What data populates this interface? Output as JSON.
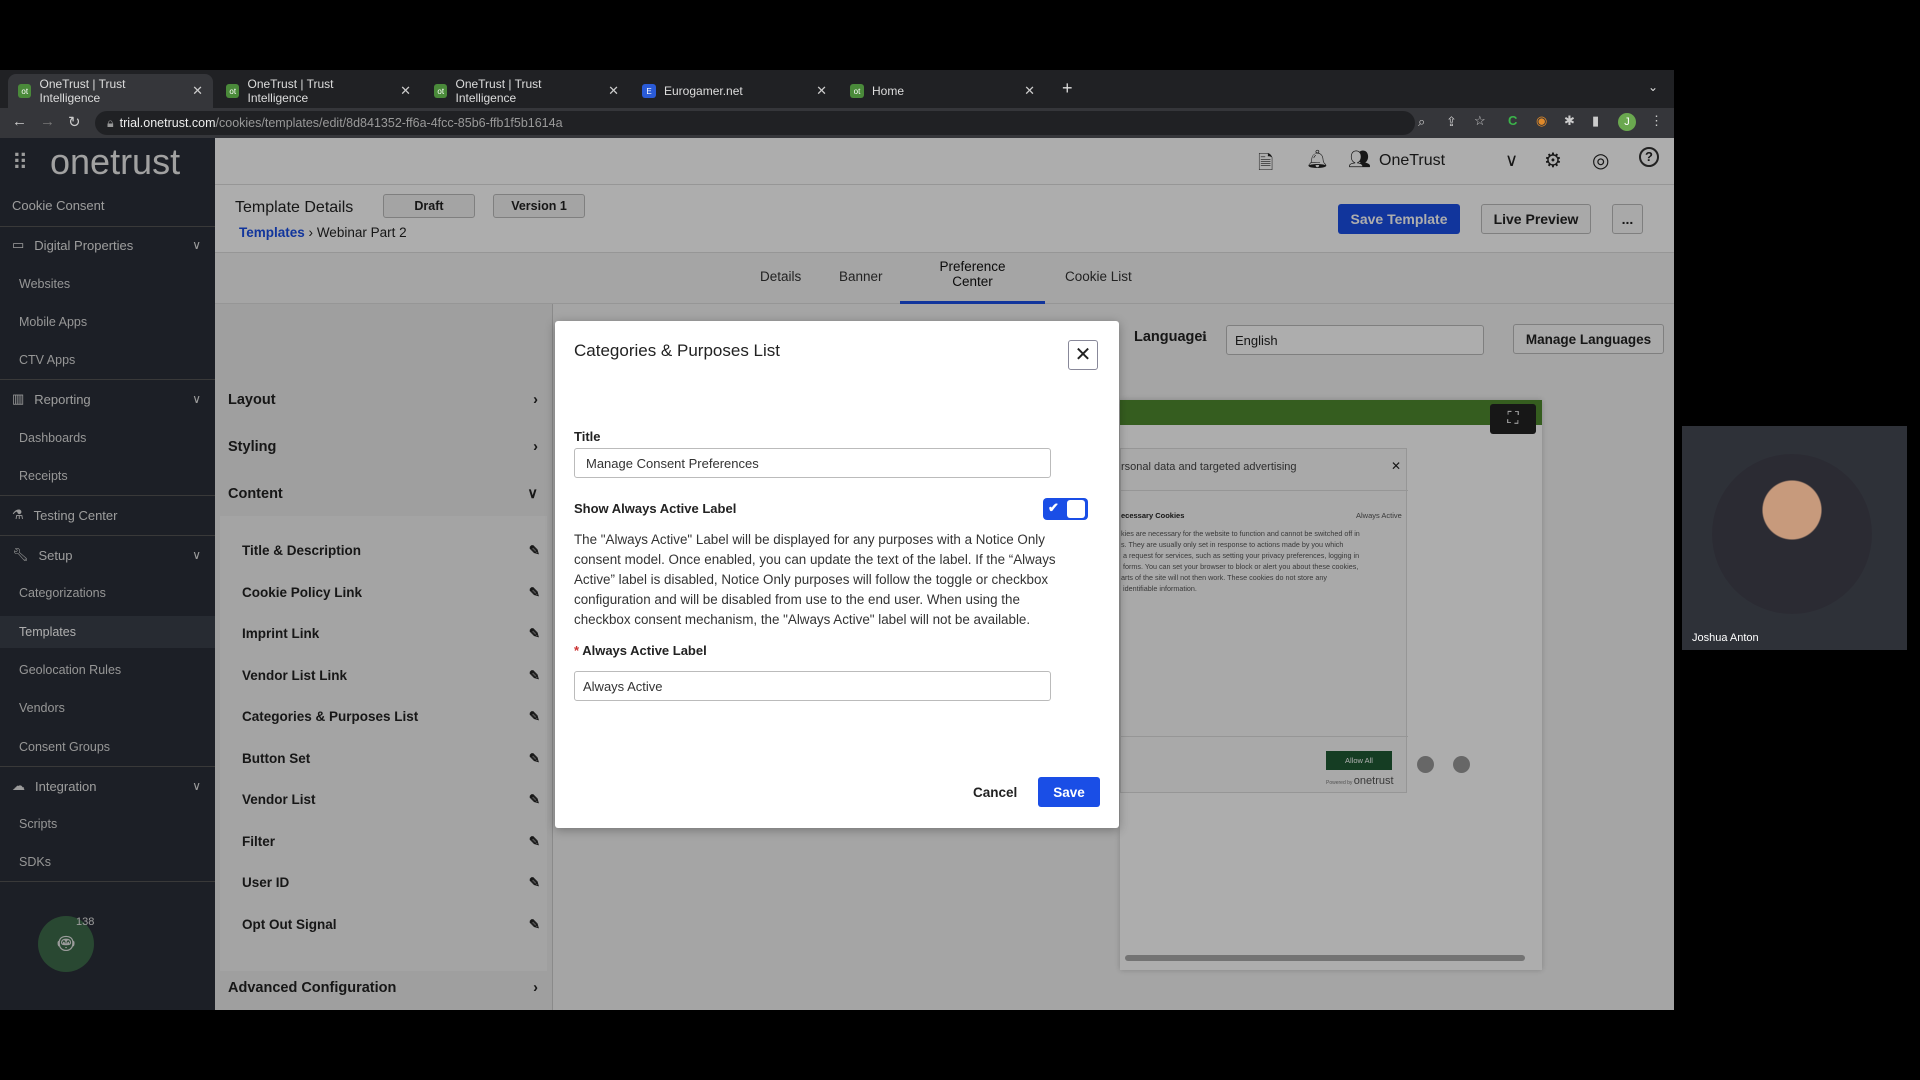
{
  "browser": {
    "tabs": [
      {
        "title": "OneTrust | Trust Intelligence",
        "icon": "ot"
      },
      {
        "title": "OneTrust | Trust Intelligence",
        "icon": "ot"
      },
      {
        "title": "OneTrust | Trust Intelligence",
        "icon": "ot"
      },
      {
        "title": "Eurogamer.net",
        "icon": "E"
      },
      {
        "title": "Home",
        "icon": "ot"
      }
    ],
    "url_host": "trial.onetrust.com",
    "url_path": "/cookies/templates/edit/8d841352-ff6a-4fcc-85b6-ffb1f5b1614a",
    "profile_initial": "J"
  },
  "logo": "onetrust",
  "sidebar": {
    "module": "Cookie Consent",
    "sections": [
      {
        "label": "Digital Properties",
        "items": [
          "Websites",
          "Mobile Apps",
          "CTV Apps"
        ]
      },
      {
        "label": "Reporting",
        "items": [
          "Dashboards",
          "Receipts"
        ]
      },
      {
        "label": "Testing Center",
        "items": []
      },
      {
        "label": "Setup",
        "items": [
          "Categorizations",
          "Templates",
          "Geolocation Rules",
          "Vendors",
          "Consent Groups"
        ]
      },
      {
        "label": "Integration",
        "items": [
          "Scripts",
          "SDKs"
        ]
      }
    ],
    "active": "Templates",
    "bot_badge": "138"
  },
  "header": {
    "org": "OneTrust"
  },
  "template": {
    "title": "Template Details",
    "status": "Draft",
    "version": "Version 1",
    "breadcrumb_root": "Templates",
    "breadcrumb_current": "Webinar Part 2",
    "save": "Save Template",
    "live_preview": "Live Preview",
    "more": "..."
  },
  "tabs": [
    "Details",
    "Banner",
    "Preference Center",
    "Cookie List"
  ],
  "active_tab": "Preference Center",
  "language": {
    "label": "Language",
    "value": "English",
    "manage": "Manage Languages"
  },
  "left_panel": {
    "sections": [
      "Layout",
      "Styling",
      "Content"
    ],
    "content_items": [
      "Title & Description",
      "Cookie Policy Link",
      "Imprint Link",
      "Vendor List Link",
      "Categories & Purposes List",
      "Button Set",
      "Vendor List",
      "Filter",
      "User ID",
      "Opt Out Signal"
    ],
    "advanced": "Advanced Configuration"
  },
  "preview": {
    "heading": "rsonal data and targeted advertising",
    "category": "ecessary Cookies",
    "always_active": "Always Active",
    "body": "kies are necessary for the website to function and cannot be switched off in\ns. They are usually only set in response to actions made by you which\n a request for services, such as setting your privacy preferences, logging in\n forms. You can set your browser to block or alert you about these cookies,\narts of the site will not then work. These cookies do not store any\n identifiable information.",
    "allow_all": "Allow All",
    "powered_by": "Powered by",
    "powered_logo": "onetrust"
  },
  "modal": {
    "title": "Categories & Purposes List",
    "title_label": "Title",
    "title_value": "Manage Consent Preferences",
    "toggle_label": "Show Always Active Label",
    "toggle_on": true,
    "description": "The \"Always Active\" Label will be displayed for any purposes with a Notice Only consent model. Once enabled, you can update the text of the label. If the “Always Active” label is disabled, Notice Only purposes will follow the toggle or checkbox configuration and will be disabled from use to the end user. When using the checkbox consent mechanism, the \"Always Active\" label will not be available.",
    "required_mark": "*",
    "label_field": "Always Active Label",
    "label_value": "Always Active",
    "cancel": "Cancel",
    "save": "Save"
  },
  "webcam": {
    "name": "Joshua Anton"
  },
  "colors": {
    "primary": "#1a4ee6",
    "preview_green": "#4e8a2e",
    "allow_all": "#1f5a34",
    "sidebar": "#2a2f38"
  }
}
